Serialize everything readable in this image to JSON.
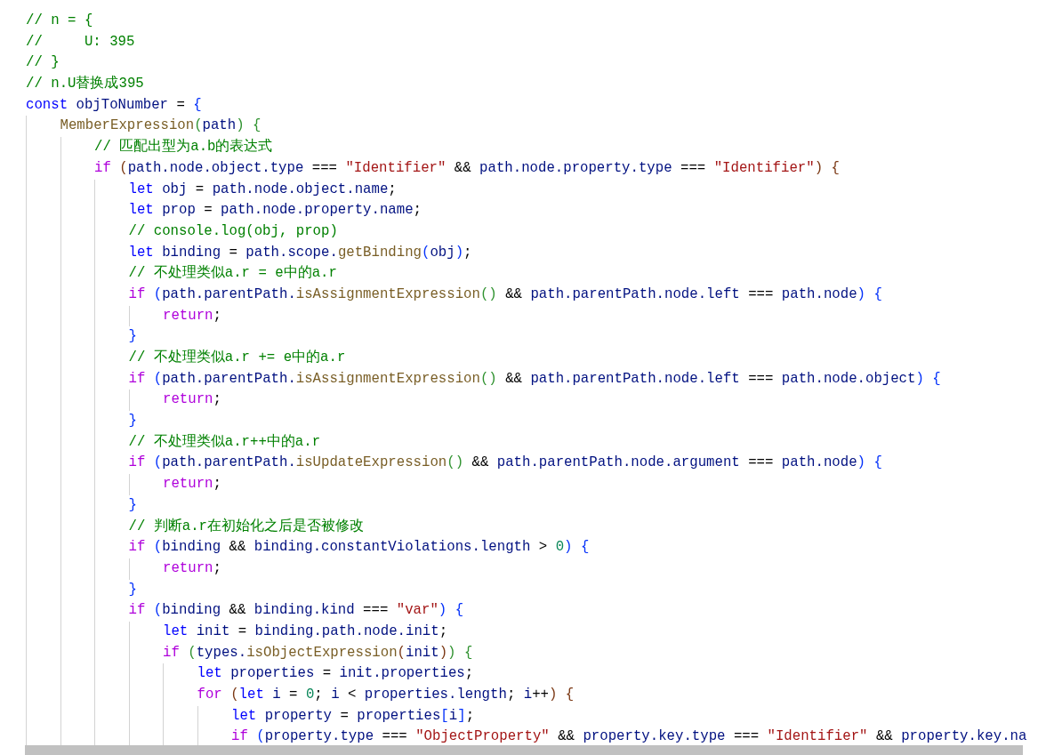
{
  "editor": {
    "lines": [
      {
        "tokens": [
          {
            "text": "// n = {",
            "kind": "cmt"
          }
        ]
      },
      {
        "tokens": [
          {
            "text": "//     U: 395",
            "kind": "cmt"
          }
        ]
      },
      {
        "tokens": [
          {
            "text": "// }",
            "kind": "cmt"
          }
        ]
      },
      {
        "tokens": [
          {
            "text": "// n.U替换成395",
            "kind": "cmt"
          }
        ]
      },
      {
        "tokens": [
          {
            "text": "const ",
            "kind": "kw"
          },
          {
            "text": "objToNumber",
            "kind": "var"
          },
          {
            "text": " = ",
            "kind": "op"
          },
          {
            "text": "{",
            "kind": "b1"
          }
        ],
        "children": [
          {
            "tokens": [
              {
                "text": "MemberExpression",
                "kind": "fn"
              },
              {
                "text": "(",
                "kind": "b2"
              },
              {
                "text": "path",
                "kind": "var"
              },
              {
                "text": ")",
                "kind": "b2"
              },
              {
                "text": " {",
                "kind": "b2"
              }
            ],
            "children": [
              {
                "tokens": [
                  {
                    "text": "// 匹配出型为a.b的表达式",
                    "kind": "cmt"
                  }
                ]
              },
              {
                "tokens": [
                  {
                    "text": "if ",
                    "kind": "ctl"
                  },
                  {
                    "text": "(",
                    "kind": "b3"
                  },
                  {
                    "text": "path.node.object.type",
                    "kind": "var"
                  },
                  {
                    "text": " === ",
                    "kind": "op"
                  },
                  {
                    "text": "\"Identifier\"",
                    "kind": "str"
                  },
                  {
                    "text": " && ",
                    "kind": "op"
                  },
                  {
                    "text": "path.node.property.type",
                    "kind": "var"
                  },
                  {
                    "text": " === ",
                    "kind": "op"
                  },
                  {
                    "text": "\"Identifier\"",
                    "kind": "str"
                  },
                  {
                    "text": ")",
                    "kind": "b3"
                  },
                  {
                    "text": " {",
                    "kind": "b3"
                  }
                ],
                "children": [
                  {
                    "tokens": [
                      {
                        "text": "let ",
                        "kind": "kw"
                      },
                      {
                        "text": "obj",
                        "kind": "var"
                      },
                      {
                        "text": " = ",
                        "kind": "op"
                      },
                      {
                        "text": "path.node.object.name",
                        "kind": "var"
                      },
                      {
                        "text": ";",
                        "kind": "op"
                      }
                    ]
                  },
                  {
                    "tokens": [
                      {
                        "text": "let ",
                        "kind": "kw"
                      },
                      {
                        "text": "prop",
                        "kind": "var"
                      },
                      {
                        "text": " = ",
                        "kind": "op"
                      },
                      {
                        "text": "path.node.property.name",
                        "kind": "var"
                      },
                      {
                        "text": ";",
                        "kind": "op"
                      }
                    ]
                  },
                  {
                    "tokens": [
                      {
                        "text": "// console.log(obj, prop)",
                        "kind": "cmt"
                      }
                    ]
                  },
                  {
                    "tokens": [
                      {
                        "text": "let ",
                        "kind": "kw"
                      },
                      {
                        "text": "binding",
                        "kind": "var"
                      },
                      {
                        "text": " = ",
                        "kind": "op"
                      },
                      {
                        "text": "path.scope.",
                        "kind": "var"
                      },
                      {
                        "text": "getBinding",
                        "kind": "fn"
                      },
                      {
                        "text": "(",
                        "kind": "b1"
                      },
                      {
                        "text": "obj",
                        "kind": "var"
                      },
                      {
                        "text": ")",
                        "kind": "b1"
                      },
                      {
                        "text": ";",
                        "kind": "op"
                      }
                    ]
                  },
                  {
                    "tokens": [
                      {
                        "text": "// 不处理类似a.r = e中的a.r",
                        "kind": "cmt"
                      }
                    ]
                  },
                  {
                    "tokens": [
                      {
                        "text": "if ",
                        "kind": "ctl"
                      },
                      {
                        "text": "(",
                        "kind": "b1"
                      },
                      {
                        "text": "path.parentPath.",
                        "kind": "var"
                      },
                      {
                        "text": "isAssignmentExpression",
                        "kind": "fn"
                      },
                      {
                        "text": "()",
                        "kind": "b2"
                      },
                      {
                        "text": " && ",
                        "kind": "op"
                      },
                      {
                        "text": "path.parentPath.node.left",
                        "kind": "var"
                      },
                      {
                        "text": " === ",
                        "kind": "op"
                      },
                      {
                        "text": "path.node",
                        "kind": "var"
                      },
                      {
                        "text": ")",
                        "kind": "b1"
                      },
                      {
                        "text": " {",
                        "kind": "b1"
                      }
                    ],
                    "children": [
                      {
                        "tokens": [
                          {
                            "text": "return",
                            "kind": "ctl"
                          },
                          {
                            "text": ";",
                            "kind": "op"
                          }
                        ]
                      }
                    ]
                  },
                  {
                    "tokens": [
                      {
                        "text": "}",
                        "kind": "b1"
                      }
                    ]
                  },
                  {
                    "tokens": [
                      {
                        "text": "// 不处理类似a.r += e中的a.r",
                        "kind": "cmt"
                      }
                    ]
                  },
                  {
                    "tokens": [
                      {
                        "text": "if ",
                        "kind": "ctl"
                      },
                      {
                        "text": "(",
                        "kind": "b1"
                      },
                      {
                        "text": "path.parentPath.",
                        "kind": "var"
                      },
                      {
                        "text": "isAssignmentExpression",
                        "kind": "fn"
                      },
                      {
                        "text": "()",
                        "kind": "b2"
                      },
                      {
                        "text": " && ",
                        "kind": "op"
                      },
                      {
                        "text": "path.parentPath.node.left",
                        "kind": "var"
                      },
                      {
                        "text": " === ",
                        "kind": "op"
                      },
                      {
                        "text": "path.node.object",
                        "kind": "var"
                      },
                      {
                        "text": ")",
                        "kind": "b1"
                      },
                      {
                        "text": " {",
                        "kind": "b1"
                      }
                    ],
                    "children": [
                      {
                        "tokens": [
                          {
                            "text": "return",
                            "kind": "ctl"
                          },
                          {
                            "text": ";",
                            "kind": "op"
                          }
                        ]
                      }
                    ]
                  },
                  {
                    "tokens": [
                      {
                        "text": "}",
                        "kind": "b1"
                      }
                    ]
                  },
                  {
                    "tokens": [
                      {
                        "text": "// 不处理类似a.r++中的a.r",
                        "kind": "cmt"
                      }
                    ]
                  },
                  {
                    "tokens": [
                      {
                        "text": "if ",
                        "kind": "ctl"
                      },
                      {
                        "text": "(",
                        "kind": "b1"
                      },
                      {
                        "text": "path.parentPath.",
                        "kind": "var"
                      },
                      {
                        "text": "isUpdateExpression",
                        "kind": "fn"
                      },
                      {
                        "text": "()",
                        "kind": "b2"
                      },
                      {
                        "text": " && ",
                        "kind": "op"
                      },
                      {
                        "text": "path.parentPath.node.argument",
                        "kind": "var"
                      },
                      {
                        "text": " === ",
                        "kind": "op"
                      },
                      {
                        "text": "path.node",
                        "kind": "var"
                      },
                      {
                        "text": ")",
                        "kind": "b1"
                      },
                      {
                        "text": " {",
                        "kind": "b1"
                      }
                    ],
                    "children": [
                      {
                        "tokens": [
                          {
                            "text": "return",
                            "kind": "ctl"
                          },
                          {
                            "text": ";",
                            "kind": "op"
                          }
                        ]
                      }
                    ]
                  },
                  {
                    "tokens": [
                      {
                        "text": "}",
                        "kind": "b1"
                      }
                    ]
                  },
                  {
                    "tokens": [
                      {
                        "text": "// 判断a.r在初始化之后是否被修改",
                        "kind": "cmt"
                      }
                    ]
                  },
                  {
                    "tokens": [
                      {
                        "text": "if ",
                        "kind": "ctl"
                      },
                      {
                        "text": "(",
                        "kind": "b1"
                      },
                      {
                        "text": "binding",
                        "kind": "var"
                      },
                      {
                        "text": " && ",
                        "kind": "op"
                      },
                      {
                        "text": "binding.constantViolations.length",
                        "kind": "var"
                      },
                      {
                        "text": " > ",
                        "kind": "op"
                      },
                      {
                        "text": "0",
                        "kind": "num"
                      },
                      {
                        "text": ")",
                        "kind": "b1"
                      },
                      {
                        "text": " {",
                        "kind": "b1"
                      }
                    ],
                    "children": [
                      {
                        "tokens": [
                          {
                            "text": "return",
                            "kind": "ctl"
                          },
                          {
                            "text": ";",
                            "kind": "op"
                          }
                        ]
                      }
                    ]
                  },
                  {
                    "tokens": [
                      {
                        "text": "}",
                        "kind": "b1"
                      }
                    ]
                  },
                  {
                    "tokens": [
                      {
                        "text": "if ",
                        "kind": "ctl"
                      },
                      {
                        "text": "(",
                        "kind": "b1"
                      },
                      {
                        "text": "binding",
                        "kind": "var"
                      },
                      {
                        "text": " && ",
                        "kind": "op"
                      },
                      {
                        "text": "binding.kind",
                        "kind": "var"
                      },
                      {
                        "text": " === ",
                        "kind": "op"
                      },
                      {
                        "text": "\"var\"",
                        "kind": "str"
                      },
                      {
                        "text": ")",
                        "kind": "b1"
                      },
                      {
                        "text": " {",
                        "kind": "b1"
                      }
                    ],
                    "children": [
                      {
                        "tokens": [
                          {
                            "text": "let ",
                            "kind": "kw"
                          },
                          {
                            "text": "init",
                            "kind": "var"
                          },
                          {
                            "text": " = ",
                            "kind": "op"
                          },
                          {
                            "text": "binding.path.node.init",
                            "kind": "var"
                          },
                          {
                            "text": ";",
                            "kind": "op"
                          }
                        ]
                      },
                      {
                        "tokens": [
                          {
                            "text": "if ",
                            "kind": "ctl"
                          },
                          {
                            "text": "(",
                            "kind": "b2"
                          },
                          {
                            "text": "types.",
                            "kind": "var"
                          },
                          {
                            "text": "isObjectExpression",
                            "kind": "fn"
                          },
                          {
                            "text": "(",
                            "kind": "b3"
                          },
                          {
                            "text": "init",
                            "kind": "var"
                          },
                          {
                            "text": ")",
                            "kind": "b3"
                          },
                          {
                            "text": ")",
                            "kind": "b2"
                          },
                          {
                            "text": " {",
                            "kind": "b2"
                          }
                        ],
                        "children": [
                          {
                            "tokens": [
                              {
                                "text": "let ",
                                "kind": "kw"
                              },
                              {
                                "text": "properties",
                                "kind": "var"
                              },
                              {
                                "text": " = ",
                                "kind": "op"
                              },
                              {
                                "text": "init.properties",
                                "kind": "var"
                              },
                              {
                                "text": ";",
                                "kind": "op"
                              }
                            ]
                          },
                          {
                            "tokens": [
                              {
                                "text": "for ",
                                "kind": "ctl"
                              },
                              {
                                "text": "(",
                                "kind": "b3"
                              },
                              {
                                "text": "let ",
                                "kind": "kw"
                              },
                              {
                                "text": "i",
                                "kind": "var"
                              },
                              {
                                "text": " = ",
                                "kind": "op"
                              },
                              {
                                "text": "0",
                                "kind": "num"
                              },
                              {
                                "text": "; ",
                                "kind": "op"
                              },
                              {
                                "text": "i",
                                "kind": "var"
                              },
                              {
                                "text": " < ",
                                "kind": "op"
                              },
                              {
                                "text": "properties.length",
                                "kind": "var"
                              },
                              {
                                "text": "; ",
                                "kind": "op"
                              },
                              {
                                "text": "i",
                                "kind": "var"
                              },
                              {
                                "text": "++",
                                "kind": "op"
                              },
                              {
                                "text": ")",
                                "kind": "b3"
                              },
                              {
                                "text": " {",
                                "kind": "b3"
                              }
                            ],
                            "children": [
                              {
                                "tokens": [
                                  {
                                    "text": "let ",
                                    "kind": "kw"
                                  },
                                  {
                                    "text": "property",
                                    "kind": "var"
                                  },
                                  {
                                    "text": " = ",
                                    "kind": "op"
                                  },
                                  {
                                    "text": "properties",
                                    "kind": "var"
                                  },
                                  {
                                    "text": "[",
                                    "kind": "b1"
                                  },
                                  {
                                    "text": "i",
                                    "kind": "var"
                                  },
                                  {
                                    "text": "]",
                                    "kind": "b1"
                                  },
                                  {
                                    "text": ";",
                                    "kind": "op"
                                  }
                                ]
                              },
                              {
                                "tokens": [
                                  {
                                    "text": "if ",
                                    "kind": "ctl"
                                  },
                                  {
                                    "text": "(",
                                    "kind": "b1"
                                  },
                                  {
                                    "text": "property.type",
                                    "kind": "var"
                                  },
                                  {
                                    "text": " === ",
                                    "kind": "op"
                                  },
                                  {
                                    "text": "\"ObjectProperty\"",
                                    "kind": "str"
                                  },
                                  {
                                    "text": " && ",
                                    "kind": "op"
                                  },
                                  {
                                    "text": "property.key.type",
                                    "kind": "var"
                                  },
                                  {
                                    "text": " === ",
                                    "kind": "op"
                                  },
                                  {
                                    "text": "\"Identifier\"",
                                    "kind": "str"
                                  },
                                  {
                                    "text": " && ",
                                    "kind": "op"
                                  },
                                  {
                                    "text": "property.key.na",
                                    "kind": "var"
                                  }
                                ]
                              }
                            ]
                          }
                        ]
                      }
                    ]
                  }
                ]
              }
            ]
          }
        ]
      }
    ]
  }
}
